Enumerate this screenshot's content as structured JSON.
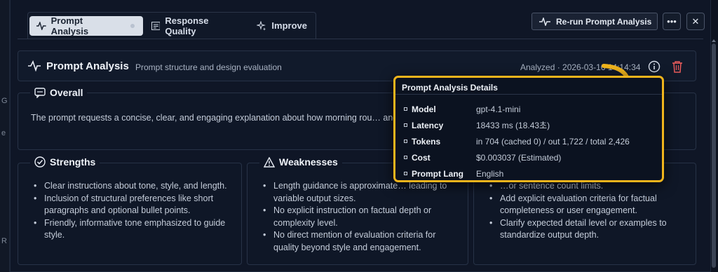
{
  "backdrop": {
    "left_chars": [
      "G",
      "e",
      "R"
    ]
  },
  "tabs": [
    {
      "label": "Prompt Analysis",
      "icon": "pulse-icon",
      "active": true
    },
    {
      "label": "Response Quality",
      "icon": "document-icon",
      "active": false
    },
    {
      "label": "Improve",
      "icon": "sparkles-icon",
      "active": false
    }
  ],
  "toolbar": {
    "rerun_label": "Re-run Prompt Analysis",
    "more_label": "•••",
    "close_label": "✕"
  },
  "header": {
    "title": "Prompt Analysis",
    "subtitle": "Prompt structure and design evaluation",
    "analyzed_meta": "Analyzed · 2026-03-16 14:14:34"
  },
  "overall": {
    "title": "Overall",
    "text": "The prompt requests a concise, clear, and engaging explanation about how morning rou… and length constraints."
  },
  "strengths": {
    "title": "Strengths",
    "items": [
      "Clear instructions about tone, style, and length.",
      "Inclusion of structural preferences like short paragraphs and optional bullet points.",
      "Friendly, informative tone emphasized to guide style."
    ]
  },
  "weaknesses": {
    "title": "Weaknesses",
    "items": [
      "Length guidance is approximate… leading to variable output sizes.",
      "No explicit instruction on factual depth or complexity level.",
      "No direct mention of evaluation criteria for quality beyond style and engagement."
    ]
  },
  "suggestions": {
    "items": [
      "…or sentence count limits.",
      "Add explicit evaluation criteria for factual completeness or user engagement.",
      "Clarify expected detail level or examples to standardize output depth."
    ]
  },
  "popover": {
    "title": "Prompt Analysis Details",
    "rows": [
      {
        "key": "Model",
        "value": "gpt-4.1-mini"
      },
      {
        "key": "Latency",
        "value": "18433 ms (18.43초)"
      },
      {
        "key": "Tokens",
        "value": "in 704 (cached 0) / out 1,722 / total 2,426"
      },
      {
        "key": "Cost",
        "value": "$0.003037 (Estimated)"
      },
      {
        "key": "Prompt Lang",
        "value": "English"
      }
    ]
  },
  "colors": {
    "highlight": "#f0b41c",
    "background": "#0f1626",
    "active_tab": "#d9dfe8"
  }
}
